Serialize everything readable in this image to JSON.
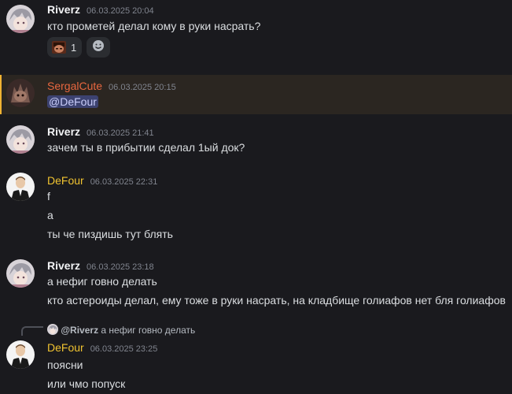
{
  "colors": {
    "riverz": "#f2f3f5",
    "sergal": "#e8673f",
    "defour": "#f0c330",
    "highlight_bg": "#2b2621"
  },
  "messages": [
    {
      "author": "Riverz",
      "time": "06.03.2025 20:04",
      "lines": [
        "кто прометей делал кому в руки насрать?"
      ],
      "reaction_count": "1",
      "add_reaction_icon": "smile-icon"
    },
    {
      "author": "SergalCute",
      "time": "06.03.2025 20:15",
      "lines": [
        "@DeFour"
      ]
    },
    {
      "author": "Riverz",
      "time": "06.03.2025 21:41",
      "lines": [
        "зачем ты в прибытии сделал 1ый док?"
      ]
    },
    {
      "author": "DeFour",
      "time": "06.03.2025 22:31",
      "lines": [
        "f",
        "a",
        "ты че пиздишь тут блять"
      ]
    },
    {
      "author": "Riverz",
      "time": "06.03.2025 23:18",
      "lines": [
        "а нефиг говно делать",
        "кто астероиды делал, ему тоже в руки насрать, на кладбище голиафов нет бля голиафов"
      ]
    },
    {
      "author": "DeFour",
      "time": "06.03.2025 23:25",
      "reply_to": "@Riverz",
      "reply_text": "а нефиг говно делать",
      "lines": [
        "поясни",
        "или чмо попуск"
      ]
    }
  ]
}
